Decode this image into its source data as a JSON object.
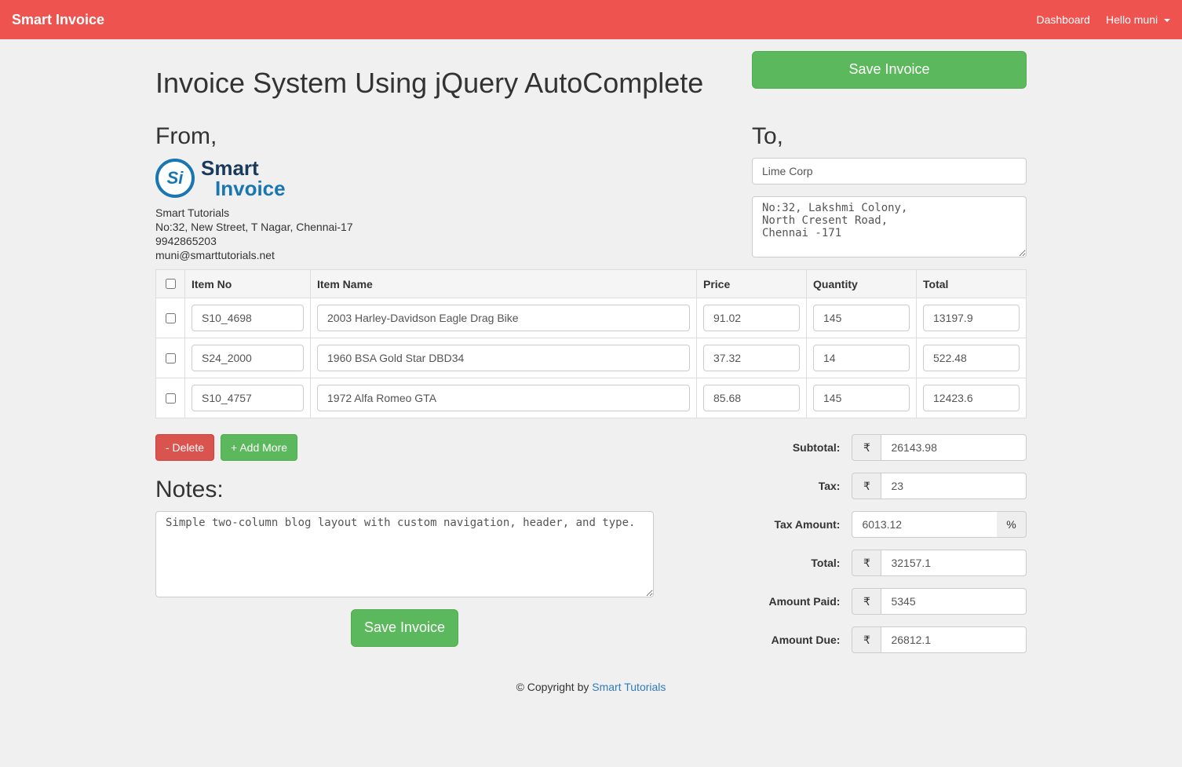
{
  "navbar": {
    "brand": "Smart Invoice",
    "dashboard": "Dashboard",
    "user_greeting": "Hello muni"
  },
  "page_title": "Invoice System Using jQuery AutoComplete",
  "save_invoice_label": "Save Invoice",
  "from": {
    "heading": "From,",
    "logo_top": "Smart",
    "logo_bottom": "Invoice",
    "company": "Smart Tutorials",
    "address": "No:32, New Street, T Nagar, Chennai-17",
    "phone": "9942865203",
    "email": "muni@smarttutorials.net"
  },
  "to": {
    "heading": "To,",
    "client_name": "Lime Corp",
    "client_address": "No:32, Lakshmi Colony,\nNorth Cresent Road,\nChennai -171"
  },
  "table": {
    "headers": {
      "item_no": "Item No",
      "item_name": "Item Name",
      "price": "Price",
      "quantity": "Quantity",
      "total": "Total"
    },
    "rows": [
      {
        "item_no": "S10_4698",
        "item_name": "2003 Harley-Davidson Eagle Drag Bike",
        "price": "91.02",
        "quantity": "145",
        "total": "13197.9"
      },
      {
        "item_no": "S24_2000",
        "item_name": "1960 BSA Gold Star DBD34",
        "price": "37.32",
        "quantity": "14",
        "total": "522.48"
      },
      {
        "item_no": "S10_4757",
        "item_name": "1972 Alfa Romeo GTA",
        "price": "85.68",
        "quantity": "145",
        "total": "12423.6"
      }
    ]
  },
  "buttons": {
    "delete": "- Delete",
    "add_more": "+ Add More"
  },
  "notes": {
    "heading": "Notes:",
    "text": "Simple two-column blog layout with custom navigation, header, and type."
  },
  "totals": {
    "subtotal_label": "Subtotal:",
    "subtotal": "26143.98",
    "tax_label": "Tax:",
    "tax": "23",
    "tax_amount_label": "Tax Amount:",
    "tax_amount": "6013.12",
    "total_label": "Total:",
    "total": "32157.1",
    "amount_paid_label": "Amount Paid:",
    "amount_paid": "5345",
    "amount_due_label": "Amount Due:",
    "amount_due": "26812.1",
    "currency_symbol": "₹",
    "percent_symbol": "%"
  },
  "footer": {
    "prefix": "© Copyright by ",
    "link": "Smart Tutorials"
  }
}
